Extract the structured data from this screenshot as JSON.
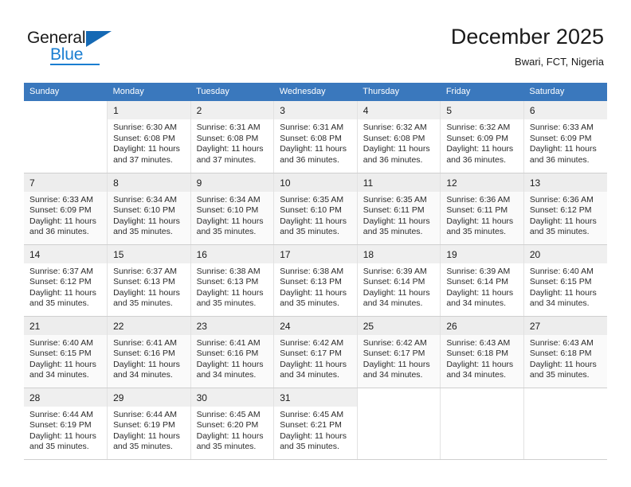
{
  "brand": {
    "name_top": "General",
    "name_bottom": "Blue",
    "triangle_color": "#1569b4",
    "blue_color": "#1a7ed1"
  },
  "header": {
    "title": "December 2025",
    "subtitle": "Bwari, FCT, Nigeria"
  },
  "theme": {
    "header_row_bg": "#3a78bd",
    "header_row_text": "#ffffff",
    "alt_row_bg": "#fafafa",
    "daynum_band_bg": "#efefef",
    "grid_line": "#cfcfcf"
  },
  "calendar": {
    "weekday_headers": [
      "Sunday",
      "Monday",
      "Tuesday",
      "Wednesday",
      "Thursday",
      "Friday",
      "Saturday"
    ],
    "labels": {
      "sunrise": "Sunrise:",
      "sunset": "Sunset:",
      "daylight": "Daylight:"
    },
    "weeks": [
      [
        {
          "day": "",
          "sunrise": "",
          "sunset": "",
          "daylight": "",
          "empty": true
        },
        {
          "day": "1",
          "sunrise": "Sunrise: 6:30 AM",
          "sunset": "Sunset: 6:08 PM",
          "daylight": "Daylight: 11 hours and 37 minutes."
        },
        {
          "day": "2",
          "sunrise": "Sunrise: 6:31 AM",
          "sunset": "Sunset: 6:08 PM",
          "daylight": "Daylight: 11 hours and 37 minutes."
        },
        {
          "day": "3",
          "sunrise": "Sunrise: 6:31 AM",
          "sunset": "Sunset: 6:08 PM",
          "daylight": "Daylight: 11 hours and 36 minutes."
        },
        {
          "day": "4",
          "sunrise": "Sunrise: 6:32 AM",
          "sunset": "Sunset: 6:08 PM",
          "daylight": "Daylight: 11 hours and 36 minutes."
        },
        {
          "day": "5",
          "sunrise": "Sunrise: 6:32 AM",
          "sunset": "Sunset: 6:09 PM",
          "daylight": "Daylight: 11 hours and 36 minutes."
        },
        {
          "day": "6",
          "sunrise": "Sunrise: 6:33 AM",
          "sunset": "Sunset: 6:09 PM",
          "daylight": "Daylight: 11 hours and 36 minutes."
        }
      ],
      [
        {
          "day": "7",
          "sunrise": "Sunrise: 6:33 AM",
          "sunset": "Sunset: 6:09 PM",
          "daylight": "Daylight: 11 hours and 36 minutes."
        },
        {
          "day": "8",
          "sunrise": "Sunrise: 6:34 AM",
          "sunset": "Sunset: 6:10 PM",
          "daylight": "Daylight: 11 hours and 35 minutes."
        },
        {
          "day": "9",
          "sunrise": "Sunrise: 6:34 AM",
          "sunset": "Sunset: 6:10 PM",
          "daylight": "Daylight: 11 hours and 35 minutes."
        },
        {
          "day": "10",
          "sunrise": "Sunrise: 6:35 AM",
          "sunset": "Sunset: 6:10 PM",
          "daylight": "Daylight: 11 hours and 35 minutes."
        },
        {
          "day": "11",
          "sunrise": "Sunrise: 6:35 AM",
          "sunset": "Sunset: 6:11 PM",
          "daylight": "Daylight: 11 hours and 35 minutes."
        },
        {
          "day": "12",
          "sunrise": "Sunrise: 6:36 AM",
          "sunset": "Sunset: 6:11 PM",
          "daylight": "Daylight: 11 hours and 35 minutes."
        },
        {
          "day": "13",
          "sunrise": "Sunrise: 6:36 AM",
          "sunset": "Sunset: 6:12 PM",
          "daylight": "Daylight: 11 hours and 35 minutes."
        }
      ],
      [
        {
          "day": "14",
          "sunrise": "Sunrise: 6:37 AM",
          "sunset": "Sunset: 6:12 PM",
          "daylight": "Daylight: 11 hours and 35 minutes."
        },
        {
          "day": "15",
          "sunrise": "Sunrise: 6:37 AM",
          "sunset": "Sunset: 6:13 PM",
          "daylight": "Daylight: 11 hours and 35 minutes."
        },
        {
          "day": "16",
          "sunrise": "Sunrise: 6:38 AM",
          "sunset": "Sunset: 6:13 PM",
          "daylight": "Daylight: 11 hours and 35 minutes."
        },
        {
          "day": "17",
          "sunrise": "Sunrise: 6:38 AM",
          "sunset": "Sunset: 6:13 PM",
          "daylight": "Daylight: 11 hours and 35 minutes."
        },
        {
          "day": "18",
          "sunrise": "Sunrise: 6:39 AM",
          "sunset": "Sunset: 6:14 PM",
          "daylight": "Daylight: 11 hours and 34 minutes."
        },
        {
          "day": "19",
          "sunrise": "Sunrise: 6:39 AM",
          "sunset": "Sunset: 6:14 PM",
          "daylight": "Daylight: 11 hours and 34 minutes."
        },
        {
          "day": "20",
          "sunrise": "Sunrise: 6:40 AM",
          "sunset": "Sunset: 6:15 PM",
          "daylight": "Daylight: 11 hours and 34 minutes."
        }
      ],
      [
        {
          "day": "21",
          "sunrise": "Sunrise: 6:40 AM",
          "sunset": "Sunset: 6:15 PM",
          "daylight": "Daylight: 11 hours and 34 minutes."
        },
        {
          "day": "22",
          "sunrise": "Sunrise: 6:41 AM",
          "sunset": "Sunset: 6:16 PM",
          "daylight": "Daylight: 11 hours and 34 minutes."
        },
        {
          "day": "23",
          "sunrise": "Sunrise: 6:41 AM",
          "sunset": "Sunset: 6:16 PM",
          "daylight": "Daylight: 11 hours and 34 minutes."
        },
        {
          "day": "24",
          "sunrise": "Sunrise: 6:42 AM",
          "sunset": "Sunset: 6:17 PM",
          "daylight": "Daylight: 11 hours and 34 minutes."
        },
        {
          "day": "25",
          "sunrise": "Sunrise: 6:42 AM",
          "sunset": "Sunset: 6:17 PM",
          "daylight": "Daylight: 11 hours and 34 minutes."
        },
        {
          "day": "26",
          "sunrise": "Sunrise: 6:43 AM",
          "sunset": "Sunset: 6:18 PM",
          "daylight": "Daylight: 11 hours and 34 minutes."
        },
        {
          "day": "27",
          "sunrise": "Sunrise: 6:43 AM",
          "sunset": "Sunset: 6:18 PM",
          "daylight": "Daylight: 11 hours and 35 minutes."
        }
      ],
      [
        {
          "day": "28",
          "sunrise": "Sunrise: 6:44 AM",
          "sunset": "Sunset: 6:19 PM",
          "daylight": "Daylight: 11 hours and 35 minutes."
        },
        {
          "day": "29",
          "sunrise": "Sunrise: 6:44 AM",
          "sunset": "Sunset: 6:19 PM",
          "daylight": "Daylight: 11 hours and 35 minutes."
        },
        {
          "day": "30",
          "sunrise": "Sunrise: 6:45 AM",
          "sunset": "Sunset: 6:20 PM",
          "daylight": "Daylight: 11 hours and 35 minutes."
        },
        {
          "day": "31",
          "sunrise": "Sunrise: 6:45 AM",
          "sunset": "Sunset: 6:21 PM",
          "daylight": "Daylight: 11 hours and 35 minutes."
        },
        {
          "day": "",
          "sunrise": "",
          "sunset": "",
          "daylight": "",
          "empty": true
        },
        {
          "day": "",
          "sunrise": "",
          "sunset": "",
          "daylight": "",
          "empty": true
        },
        {
          "day": "",
          "sunrise": "",
          "sunset": "",
          "daylight": "",
          "empty": true
        }
      ]
    ]
  }
}
